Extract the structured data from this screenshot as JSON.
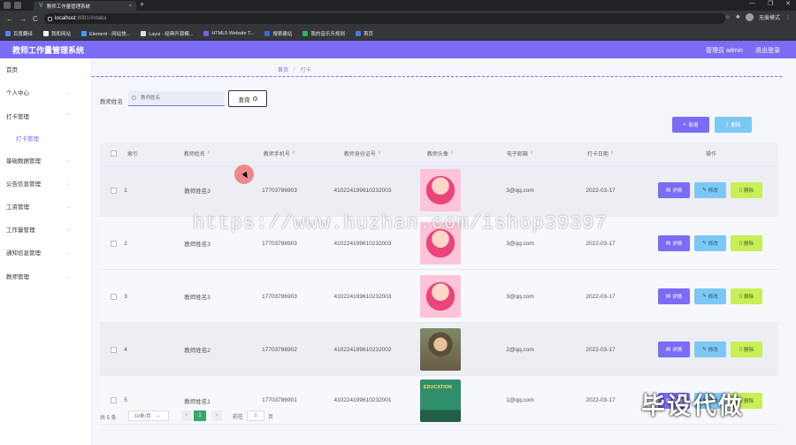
{
  "browser": {
    "tab_title": "教师工作量管理系统",
    "tab_close": "×",
    "new_tab": "+",
    "url_host": "localhost",
    "url_path": ":8081/#/daka",
    "guest_label": "无痕模式",
    "back": "←",
    "forward": "→",
    "reload": "C",
    "bookmarks": [
      "百度翻译",
      "我和网站",
      "Element - 网站快...",
      "Layui - 经典开源模...",
      "HTML5 Website T...",
      "搜索建站",
      "我的音乐乐规则",
      "首页"
    ]
  },
  "header": {
    "title": "教师工作量管理系统",
    "user": "管理员 admin",
    "logout": "退出登录"
  },
  "sidebar": {
    "items": [
      {
        "label": "首页"
      },
      {
        "label": "个人中心"
      },
      {
        "label": "打卡管理"
      },
      {
        "label": "打卡管理"
      },
      {
        "label": "基础数据管理"
      },
      {
        "label": "公告信息管理"
      },
      {
        "label": "工资管理"
      },
      {
        "label": "工作量管理"
      },
      {
        "label": "通知信息管理"
      },
      {
        "label": "教师管理"
      }
    ]
  },
  "breadcrumb": {
    "home": "首页",
    "sep": "/",
    "current": "打卡"
  },
  "search": {
    "label": "教师姓名",
    "placeholder": "教师姓名",
    "button": "查询"
  },
  "toolbar": {
    "add": "新增",
    "delete": "删除",
    "add_icon": "+",
    "delete_icon": "▯"
  },
  "table": {
    "headers": [
      "索引",
      "教师姓名",
      "教师手机号",
      "教师身份证号",
      "教师头像",
      "电子邮箱",
      "打卡日期",
      "操作"
    ],
    "sort_icon": "⇕",
    "rows": [
      {
        "index": "1",
        "name": "教师姓名3",
        "phone": "17703786903",
        "idcard": "410224199610232003",
        "avatar": "girl",
        "email": "3@qq.com",
        "date": "2022-03-17"
      },
      {
        "index": "2",
        "name": "教师姓名3",
        "phone": "17703786903",
        "idcard": "410224199610232003",
        "avatar": "girl",
        "email": "3@qq.com",
        "date": "2022-03-17"
      },
      {
        "index": "3",
        "name": "教师姓名3",
        "phone": "17703786903",
        "idcard": "410224199610232003",
        "avatar": "girl",
        "email": "3@qq.com",
        "date": "2022-03-17"
      },
      {
        "index": "4",
        "name": "教师姓名2",
        "phone": "17703786902",
        "idcard": "410224199610232002",
        "avatar": "old",
        "email": "2@qq.com",
        "date": "2022-03-17"
      },
      {
        "index": "5",
        "name": "教师姓名1",
        "phone": "17703786901",
        "idcard": "410224199610232001",
        "avatar": "edu",
        "email": "1@qq.com",
        "date": "2022-03-17"
      }
    ],
    "avatar_edu_text": "EDUCATION",
    "actions": {
      "detail": "详情",
      "edit": "修改",
      "delete": "删除"
    }
  },
  "pagination": {
    "total": "共 5 条",
    "size": "10条/页",
    "prev": "<",
    "page": "1",
    "next": ">",
    "goto": "前往",
    "goto_value": "1",
    "page_suffix": "页"
  },
  "overlay": {
    "watermark": "https://www.huzhan.com/ishop39397",
    "promo": "毕设代做"
  },
  "colors": {
    "accent": "#7b6cf6",
    "info": "#7cc8f5",
    "danger": "#c8ef57",
    "page_active": "#35a86b"
  }
}
